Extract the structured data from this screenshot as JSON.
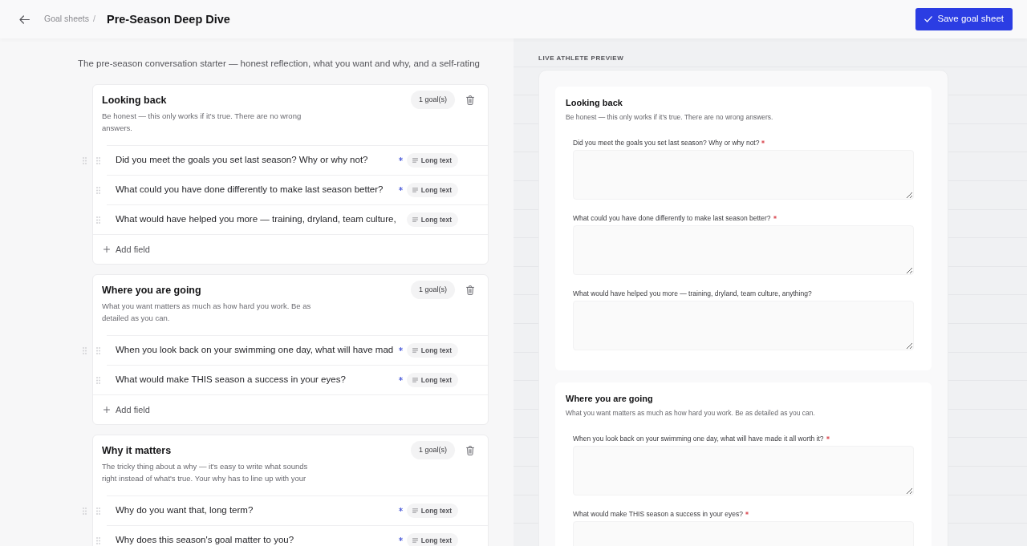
{
  "header": {
    "breadcrumb": "Goal sheets",
    "breadcrumb_separator": "/",
    "title": "Pre-Season Deep Dive",
    "save_button": "Save goal sheet"
  },
  "editor": {
    "intro": "The pre-season conversation starter — honest reflection, what you want and why, and a self-rating",
    "sections": [
      {
        "title": "Looking back",
        "description": "Be honest — this only works if it's true. There are no wrong answers.",
        "goal_count": "1 goal(s)",
        "fields": [
          {
            "question": "Did you meet the goals you set last season? Why or why not?",
            "required": true,
            "type_label": "Long text"
          },
          {
            "question": "What could you have done differently to make last season better?",
            "required": true,
            "type_label": "Long text"
          },
          {
            "question": "What would have helped you more — training, dryland, team culture,",
            "required": false,
            "type_label": "Long text"
          }
        ],
        "add_field": "Add field"
      },
      {
        "title": "Where you are going",
        "description": "What you want matters as much as how hard you work. Be as detailed as you can.",
        "goal_count": "1 goal(s)",
        "fields": [
          {
            "question": "When you look back on your swimming one day, what will have mad",
            "required": true,
            "type_label": "Long text"
          },
          {
            "question": "What would make THIS season a success in your eyes?",
            "required": true,
            "type_label": "Long text"
          }
        ],
        "add_field": "Add field"
      },
      {
        "title": "Why it matters",
        "description": "The tricky thing about a why — it's easy to write what sounds right instead of what's true. Your why has to line up with your",
        "goal_count": "1 goal(s)",
        "fields": [
          {
            "question": "Why do you want that, long term?",
            "required": true,
            "type_label": "Long text"
          },
          {
            "question": "Why does this season's goal matter to you?",
            "required": true,
            "type_label": "Long text"
          }
        ]
      }
    ]
  },
  "preview": {
    "heading": "LIVE ATHLETE PREVIEW",
    "sections": [
      {
        "title": "Looking back",
        "description": "Be honest — this only works if it's true. There are no wrong answers.",
        "fields": [
          {
            "label": "Did you meet the goals you set last season? Why or why not?",
            "required": true
          },
          {
            "label": "What could you have done differently to make last season better?",
            "required": true
          },
          {
            "label": "What would have helped you more — training, dryland, team culture, anything?",
            "required": false
          }
        ]
      },
      {
        "title": "Where you are going",
        "description": "What you want matters as much as how hard you work. Be as detailed as you can.",
        "fields": [
          {
            "label": "When you look back on your swimming one day, what will have made it all worth it?",
            "required": true
          },
          {
            "label": "What would make THIS season a success in your eyes?",
            "required": true
          }
        ]
      }
    ]
  }
}
